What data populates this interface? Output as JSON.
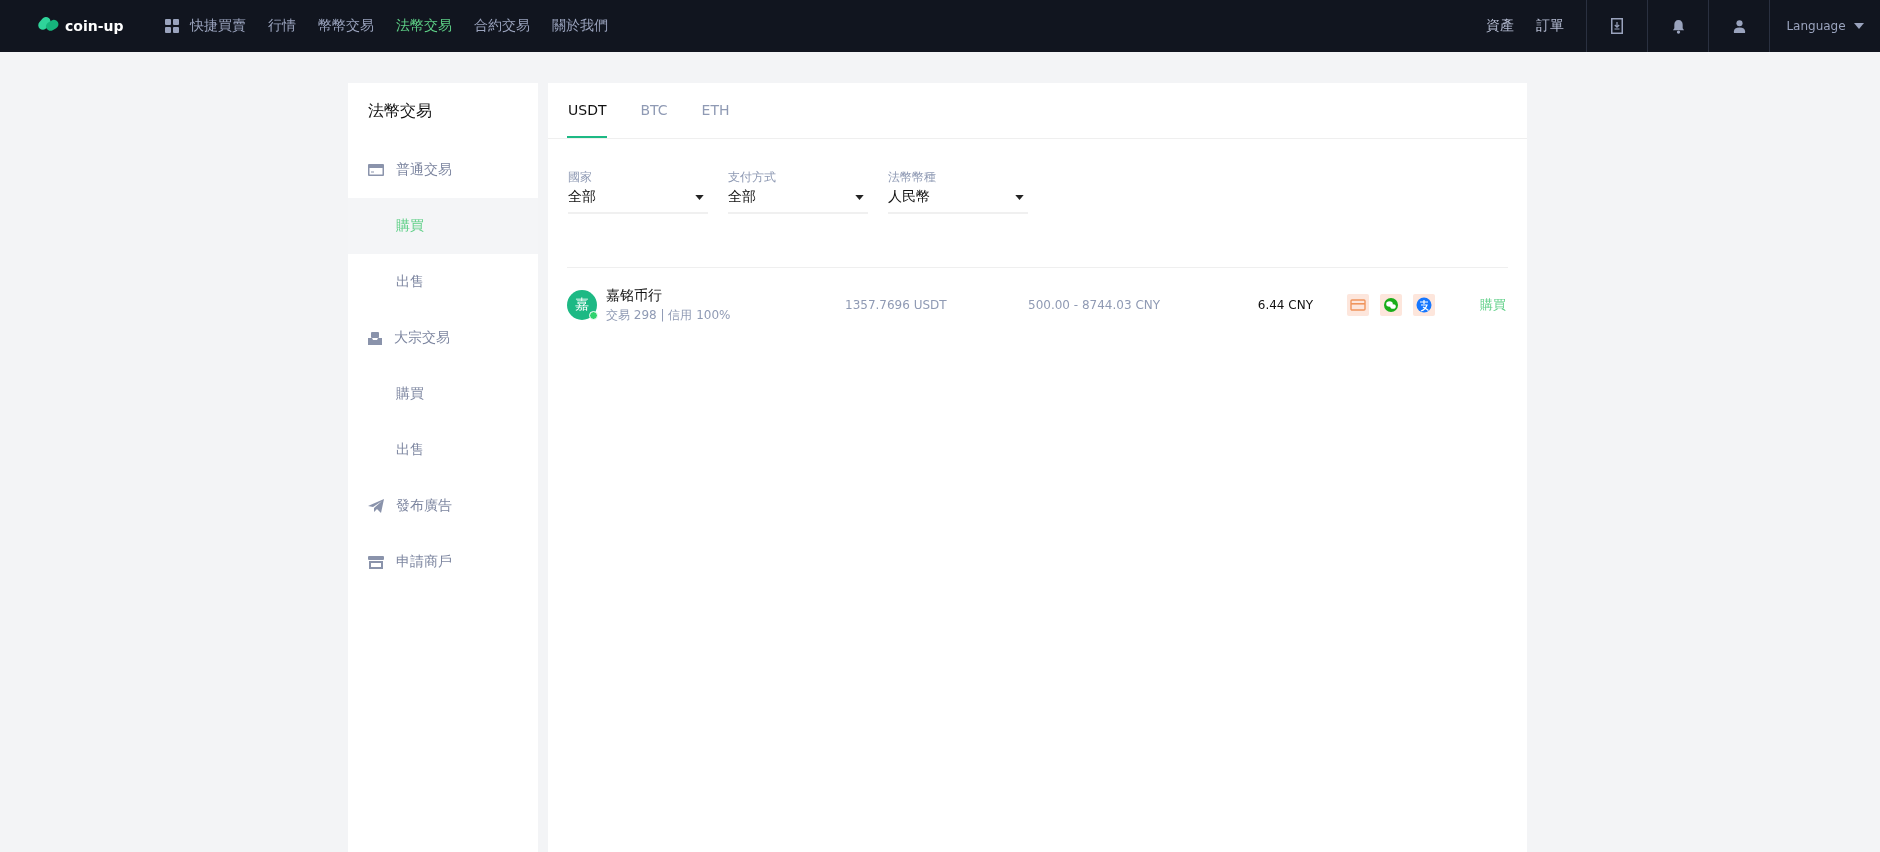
{
  "header": {
    "logo": "coin-up",
    "nav": [
      {
        "label": "快捷買賣",
        "selected": false
      },
      {
        "label": "行情",
        "selected": false
      },
      {
        "label": "幣幣交易",
        "selected": false
      },
      {
        "label": "法幣交易",
        "selected": true
      },
      {
        "label": "合約交易",
        "selected": false
      },
      {
        "label": "關於我們",
        "selected": false
      }
    ],
    "right_links": [
      "資產",
      "訂單"
    ],
    "language": "Language"
  },
  "sidebar": {
    "title": "法幣交易",
    "groups": [
      {
        "label": "普通交易",
        "kind": "card",
        "children": [
          {
            "label": "購買",
            "selected": true
          },
          {
            "label": "出售",
            "selected": false
          }
        ]
      },
      {
        "label": "大宗交易",
        "kind": "inbox",
        "children": [
          {
            "label": "購買",
            "selected": false
          },
          {
            "label": "出售",
            "selected": false
          }
        ]
      },
      {
        "label": "發布廣告",
        "kind": "plane"
      },
      {
        "label": "申請商戶",
        "kind": "store"
      }
    ]
  },
  "tabs": [
    {
      "label": "USDT",
      "selected": true
    },
    {
      "label": "BTC",
      "selected": false
    },
    {
      "label": "ETH",
      "selected": false
    }
  ],
  "filters": [
    {
      "label": "國家",
      "value": "全部"
    },
    {
      "label": "支付方式",
      "value": "全部"
    },
    {
      "label": "法幣幣種",
      "value": "人民幣"
    }
  ],
  "offers": [
    {
      "avatar": "嘉",
      "online": true,
      "name": "嘉铭币行",
      "stats": "交易 298 | 信用 100%",
      "amount": "1357.7696 USDT",
      "limit": "500.00 - 8744.03 CNY",
      "price": "6.44 CNY",
      "payments": [
        {
          "kind": "bank"
        },
        {
          "kind": "wechat"
        },
        {
          "kind": "alipay"
        }
      ],
      "action": "購買"
    }
  ]
}
